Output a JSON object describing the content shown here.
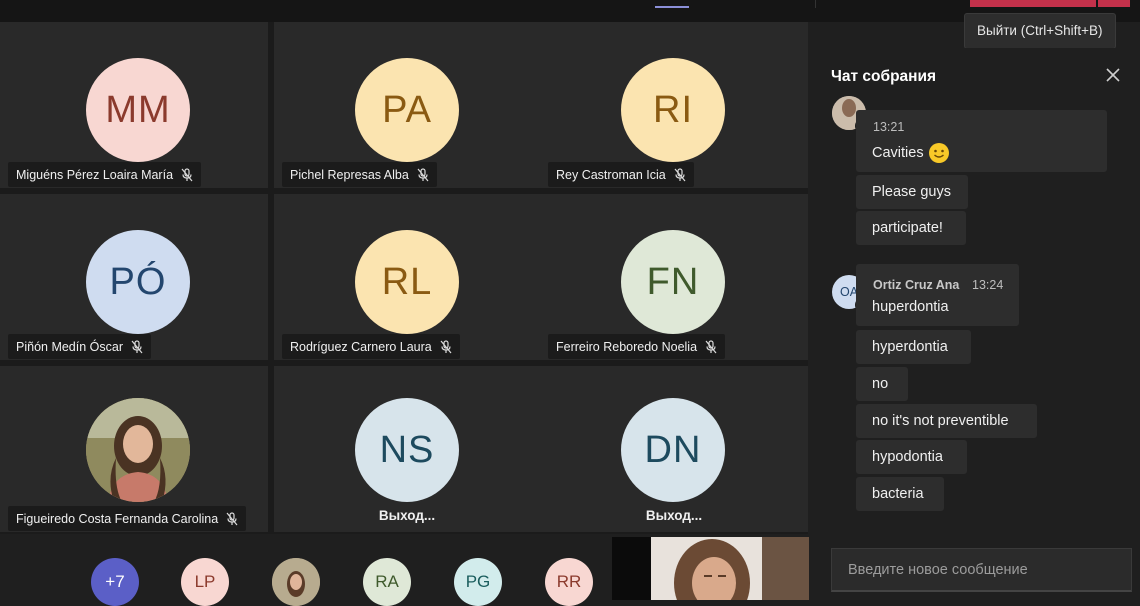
{
  "tooltip": {
    "leave": "Выйти (Ctrl+Shift+B)"
  },
  "colors": {
    "leave_red": "#c4314b",
    "accent": "#8b8fd8",
    "presence_online": "#6bb700",
    "presence_busy": "#c4314b"
  },
  "participants": [
    {
      "initials": "MM",
      "name": "Miguéns Pérez Loaira María",
      "bg": "#f8d7d2",
      "fg": "#8b3a2d",
      "muted": true,
      "status": ""
    },
    {
      "initials": "PA",
      "name": "Pichel Represas Alba",
      "bg": "#fbe4b0",
      "fg": "#8a5a12",
      "muted": true,
      "status": ""
    },
    {
      "initials": "RI",
      "name": "Rey Castroman Icia",
      "bg": "#fbe4b0",
      "fg": "#8a5a12",
      "muted": true,
      "status": ""
    },
    {
      "initials": "PÓ",
      "name": "Piñón Medín Óscar",
      "bg": "#cfdcf0",
      "fg": "#23466e",
      "muted": true,
      "status": ""
    },
    {
      "initials": "RL",
      "name": "Rodríguez Carnero Laura",
      "bg": "#fbe4b0",
      "fg": "#8a5a12",
      "muted": true,
      "status": ""
    },
    {
      "initials": "FN",
      "name": "Ferreiro Reboredo Noelia",
      "bg": "#dfe8d7",
      "fg": "#3f5a2c",
      "muted": true,
      "status": ""
    },
    {
      "initials": "",
      "name": "Figueiredo Costa Fernanda Carolina",
      "bg": "#b0a37c",
      "fg": "#000000",
      "muted": true,
      "status": "",
      "photo": true
    },
    {
      "initials": "NS",
      "name": "",
      "bg": "#d7e4eb",
      "fg": "#1d4a5e",
      "muted": false,
      "status": "Выход..."
    },
    {
      "initials": "DN",
      "name": "",
      "bg": "#d7e4eb",
      "fg": "#1d4a5e",
      "muted": false,
      "status": "Выход..."
    }
  ],
  "roster": [
    {
      "initials": "+7",
      "bg": "#5b5fc7",
      "fg": "#ffffff"
    },
    {
      "initials": "LP",
      "bg": "#f8d7d2",
      "fg": "#8b3a2d"
    },
    {
      "initials": "",
      "bg": "#9a8d70",
      "fg": "#000000",
      "photo": true
    },
    {
      "initials": "RA",
      "bg": "#dfe8d7",
      "fg": "#3f5a2c"
    },
    {
      "initials": "PG",
      "bg": "#d2ecec",
      "fg": "#1b5e5e"
    },
    {
      "initials": "RR",
      "bg": "#f8d7d2",
      "fg": "#8b3a2d"
    }
  ],
  "chat": {
    "title": "Чат собрания",
    "group1": {
      "time": "13:21",
      "messages": [
        "Cavities",
        "Please guys",
        "participate!"
      ]
    },
    "group2": {
      "avatar_initials": "OA",
      "author": "Ortiz Cruz Ana",
      "time": "13:24",
      "messages": [
        "huperdontia",
        "hyperdontia",
        "no",
        "no it's not preventible",
        "hypodontia",
        "bacteria"
      ]
    },
    "input_placeholder": "Введите новое сообщение"
  }
}
